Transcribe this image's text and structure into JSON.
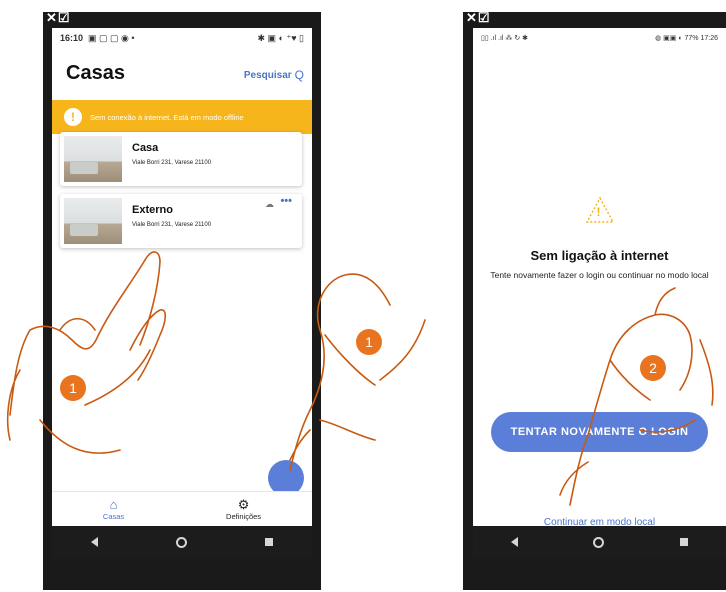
{
  "left_screen": {
    "close_glyph": "✕☑",
    "status_time": "16:10",
    "status_left_icons": "▣ ▢ ▢ ◉ •",
    "status_right_icons": "✱ ▣ ◐ ⁺♥ ▯",
    "title": "Casas",
    "search_label": "Pesquisar",
    "search_icon": "Q",
    "banner": {
      "icon": "!",
      "text": "Sem conexão à internet. Está em modo offline",
      "color": "#f7b51c"
    },
    "homes": [
      {
        "name": "Casa",
        "address": "Viale Borri 231, Varese 21100"
      },
      {
        "name": "Externo",
        "address": "Viale Borri 231, Varese 21100",
        "cloud_icon": "☁",
        "more_icon": "•••"
      }
    ],
    "tabs": [
      {
        "label": "Casas",
        "icon": "⌂"
      },
      {
        "label": "Definições",
        "icon": "⚙"
      }
    ]
  },
  "right_screen": {
    "close_glyph": "✕☑",
    "status_left_icons": "▯▯ .ıl .ıl ⁂ ↻ ✱",
    "status_right_icons": "◍ ▣▣ ◐ 77%",
    "status_time": "17:26",
    "warning_icon": "!",
    "title": "Sem ligação à internet",
    "description": "Tente novamente fazer o login ou continuar no modo local",
    "retry_button": "TENTAR NOVAMENTE O LOGIN",
    "local_mode_link": "Continuar em modo local"
  },
  "annotations": {
    "step_left_1": "1",
    "step_left_2": "1",
    "step_right": "2",
    "hand_color": "#c85a12",
    "badge_color": "#e8741f"
  },
  "accent_color": "#4a74c9"
}
